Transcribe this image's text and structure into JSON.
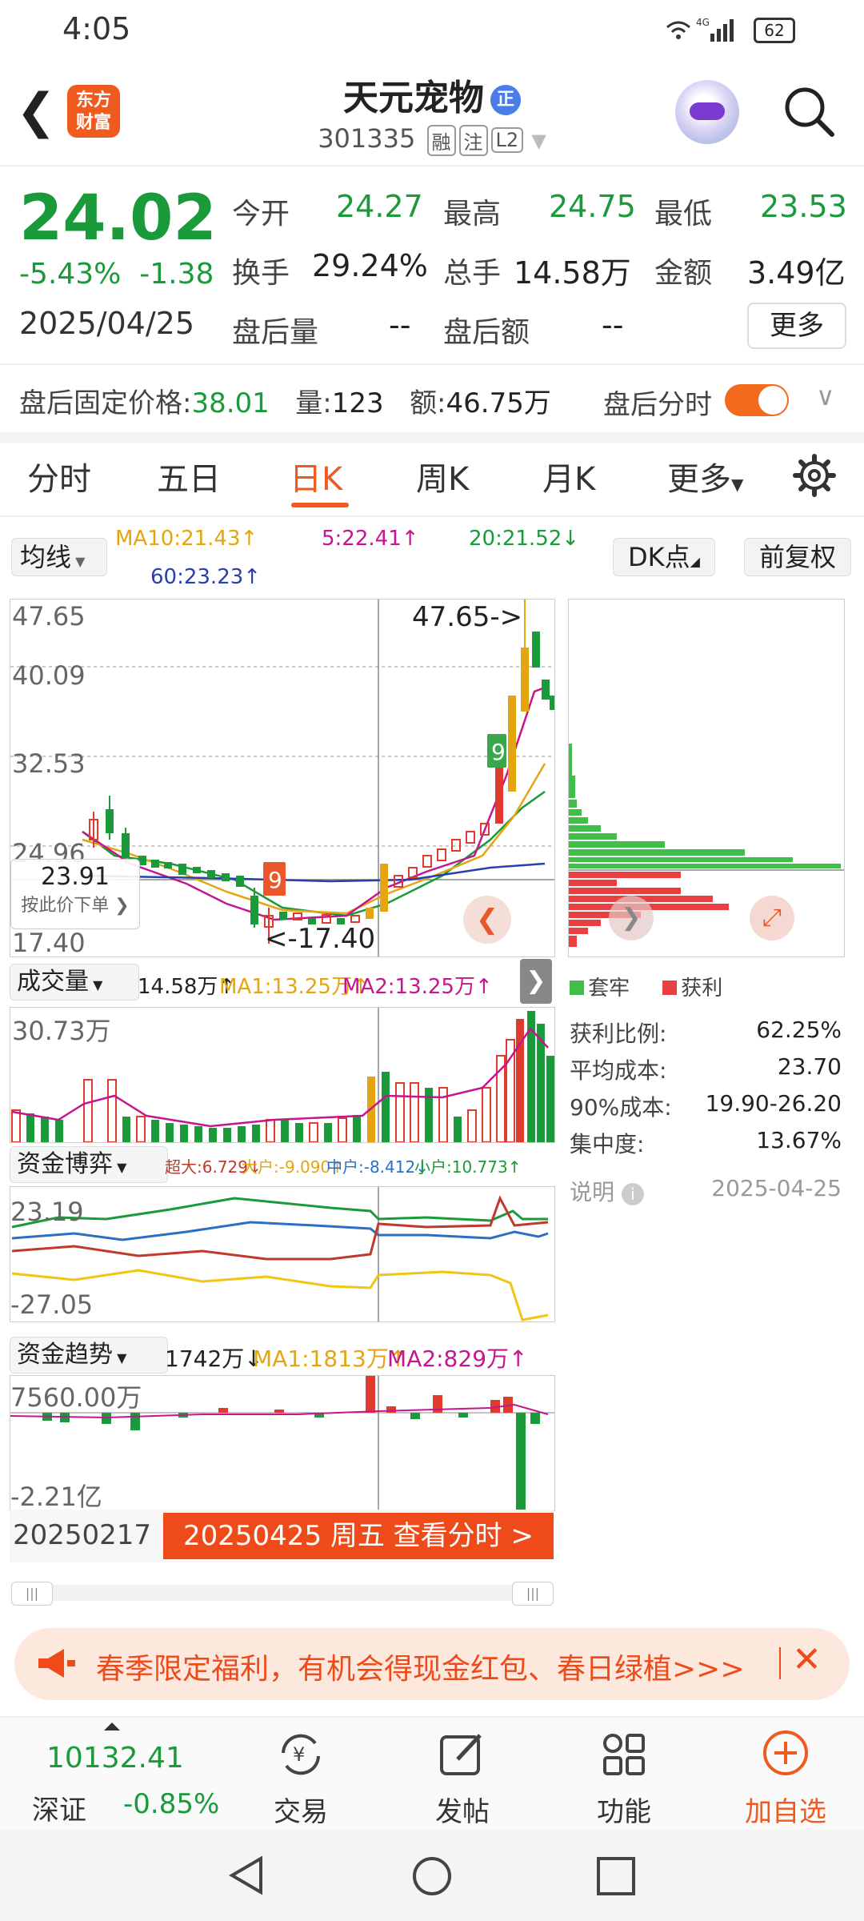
{
  "status": {
    "time": "4:05",
    "battery": "62"
  },
  "header": {
    "logo_line1": "东方",
    "logo_line2": "财富",
    "stock_name": "天元宠物",
    "name_badge": "正",
    "code": "301335",
    "tags": [
      "融",
      "注",
      "L2"
    ]
  },
  "quote": {
    "price": "24.02",
    "change_pct": "-5.43%",
    "change": "-1.38",
    "date": "2025/04/25",
    "open_label": "今开",
    "open": "24.27",
    "high_label": "最高",
    "high": "24.75",
    "low_label": "最低",
    "low": "23.53",
    "turnover_label": "换手",
    "turnover": "29.24%",
    "volume_label": "总手",
    "volume": "14.58万",
    "amount_label": "金额",
    "amount": "3.49亿",
    "after_vol_label": "盘后量",
    "after_vol": "--",
    "after_amt_label": "盘后额",
    "after_amt": "--",
    "more": "更多"
  },
  "after_hours": {
    "fixed_price_label": "盘后固定价格:",
    "fixed_price": "38.01",
    "qty_label": "量:",
    "qty": "123",
    "amt_label": "额:",
    "amt": "46.75万",
    "intraday_label": "盘后分时"
  },
  "tabs": [
    "分时",
    "五日",
    "日K",
    "周K",
    "月K",
    "更多"
  ],
  "chart_controls": {
    "ma_select": "均线",
    "dk": "DK点",
    "adjust": "前复权"
  },
  "ma_legend": {
    "ma10": "MA10:21.43↑",
    "ma5": "5:22.41↑",
    "ma20": "20:21.52↓",
    "ma60": "60:23.23↑"
  },
  "kline": {
    "y_labels": [
      "47.65",
      "40.09",
      "32.53",
      "24.96",
      "17.40"
    ],
    "max_marker": "47.65->",
    "min_marker": "<-17.40",
    "crosshair_price": "23.91",
    "crosshair_hint": "按此价下单"
  },
  "volume_panel": {
    "select": "成交量",
    "value": "14.58万↑",
    "ma1": "MA1:13.25万↑",
    "ma2": "MA2:13.25万↑",
    "y_label": "30.73万"
  },
  "fund_game": {
    "select": "资金博弈",
    "super": "超大:6.729↓",
    "large": "大户:-9.090↑",
    "mid": "中户:-8.412↓",
    "small": "小户:10.773↑",
    "y_top": "23.19",
    "y_bot": "-27.05"
  },
  "fund_trend": {
    "select": "资金趋势",
    "value": "1742万↓",
    "ma1": "MA1:1813万↑",
    "ma2": "MA2:829万↑",
    "y_top": "7560.00万",
    "y_bot": "-2.21亿"
  },
  "date_axis": {
    "start": "20250217",
    "selected": "20250425 周五 查看分时 >"
  },
  "chip_dist": {
    "trap_label": "套牢",
    "profit_label": "获利",
    "rows": [
      {
        "label": "获利比例:",
        "value": "62.25%"
      },
      {
        "label": "平均成本:",
        "value": "23.70"
      },
      {
        "label": "90%成本:",
        "value": "19.90-26.20"
      },
      {
        "label": "集中度:",
        "value": "13.67%"
      }
    ],
    "note_label": "说明",
    "note_date": "2025-04-25"
  },
  "banner": {
    "text": "春季限定福利，有机会得现金红包、春日绿植>>>"
  },
  "bottom_nav": {
    "index_value": "10132.41",
    "index_name": "深证",
    "index_change": "-0.85%",
    "items": [
      "交易",
      "发帖",
      "功能",
      "加自选"
    ]
  },
  "colors": {
    "up": "#e03a2e",
    "down": "#1a9a3a",
    "accent": "#ef5a1f"
  }
}
